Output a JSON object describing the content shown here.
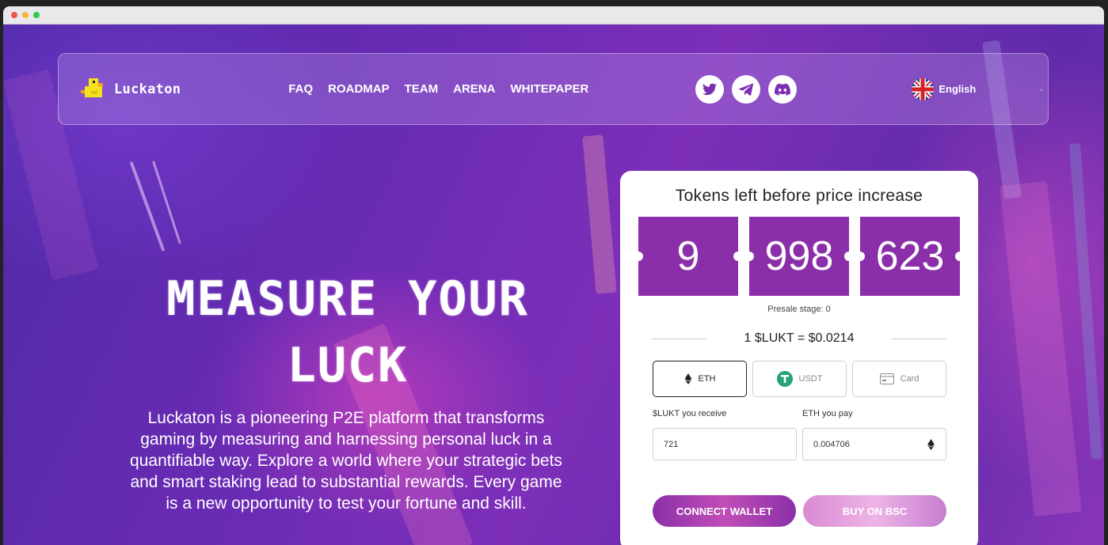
{
  "window": {
    "controls": [
      "close",
      "minimize",
      "maximize"
    ],
    "control_colors": [
      "#f2544c",
      "#f6b73b",
      "#34c748"
    ]
  },
  "nav": {
    "logo_text": "Luckaton",
    "links": [
      "FAQ",
      "ROADMAP",
      "TEAM",
      "ARENA",
      "WHITEPAPER"
    ],
    "socials": [
      "twitter-icon",
      "telegram-icon",
      "discord-icon"
    ],
    "language": "English"
  },
  "hero": {
    "title_line1": "MEASURE YOUR",
    "title_line2": "LUCK",
    "description": "Luckaton is a pioneering P2E platform that transforms gaming by measuring and harnessing personal luck in a quantifiable way. Explore a world where your strategic bets and smart staking lead to substantial rewards. Every game is a new opportunity to test your fortune and skill."
  },
  "presale": {
    "title": "Tokens left before price increase",
    "counter": [
      "9",
      "998",
      "623"
    ],
    "stage": "Presale stage: 0",
    "price": "1 $LUKT = $0.0214",
    "pay_tabs": [
      {
        "label": "ETH",
        "icon": "eth-icon",
        "active": true
      },
      {
        "label": "USDT",
        "icon": "usdt-icon",
        "active": false
      },
      {
        "label": "Card",
        "icon": "card-icon",
        "active": false
      }
    ],
    "receive_label": "$LUKT you receive",
    "receive_value": "721",
    "pay_label": "ETH you pay",
    "pay_value": "0.004706",
    "connect_label": "CONNECT WALLET",
    "bsc_label": "BUY ON BSC"
  },
  "colors": {
    "accent": "#8a2ea9",
    "usdt": "#26a17b"
  }
}
